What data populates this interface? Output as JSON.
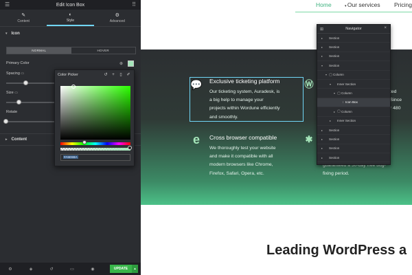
{
  "editor": {
    "title": "Edit Icon Box",
    "tabs": [
      {
        "label": "Content",
        "icon": "pencil-icon"
      },
      {
        "label": "Style",
        "icon": "half-circle-icon"
      },
      {
        "label": "Advanced",
        "icon": "gear-icon"
      }
    ],
    "icon_section": "Icon",
    "state_toggle": {
      "normal": "NORMAL",
      "hover": "HOVER"
    },
    "primary_color_label": "Primary Color",
    "primary_color": "#a5e6ba",
    "spacing_label": "Spacing",
    "size_label": "Size",
    "rotate_label": "Rotate",
    "content_section": "Content",
    "update_label": "UPDATE"
  },
  "color_picker": {
    "title": "Color Picker",
    "hex_value": "#A5E6BA"
  },
  "site": {
    "nav": {
      "home": "Home",
      "services": "Our services",
      "pricing": "Pricing"
    },
    "features": [
      {
        "title": "Exclusive ticketing platform",
        "lines": [
          "Our ticketing system, Auradesk, is",
          "a big help to manage your",
          "projects within Wordune efficiently",
          "and smoothly."
        ],
        "icon": "speech-bubble-icon"
      },
      {
        "title": "Cross browser compatible",
        "lines": [
          "We thoroughly test your website",
          "and make it compatible with all",
          "modern browsers like Chrome,",
          "Firefox, Safari, Opera, etc."
        ],
        "icon": "edge-browser-icon"
      }
    ],
    "partial_text": {
      "right1": "ted",
      "right2": "Since",
      "right3": "r 480",
      "right4": "f",
      "guarantee1": "guaranteed a 30-day free bug-",
      "guarantee2": "fixing period."
    },
    "headline": "Leading WordPress a"
  },
  "navigator": {
    "title": "Navigator",
    "rows": [
      {
        "label": "Section",
        "indent": 0,
        "caret": "▸"
      },
      {
        "label": "Section",
        "indent": 0,
        "caret": "▸"
      },
      {
        "label": "Section",
        "indent": 0,
        "caret": "▸"
      },
      {
        "label": "Section",
        "indent": 0,
        "caret": "▾"
      },
      {
        "label": "Column",
        "indent": 1,
        "caret": "▾"
      },
      {
        "label": "Inner Section",
        "indent": 2,
        "caret": "▾"
      },
      {
        "label": "Column",
        "indent": 3,
        "caret": "▾"
      },
      {
        "label": "Icon Box",
        "indent": 4,
        "caret": ""
      },
      {
        "label": "Column",
        "indent": 3,
        "caret": "▸"
      },
      {
        "label": "Inner Section",
        "indent": 2,
        "caret": "▸"
      },
      {
        "label": "Section",
        "indent": 0,
        "caret": "▸"
      },
      {
        "label": "Section",
        "indent": 0,
        "caret": "▸"
      },
      {
        "label": "Section",
        "indent": 0,
        "caret": "▸"
      },
      {
        "label": "Section",
        "indent": 0,
        "caret": "▸"
      }
    ]
  }
}
